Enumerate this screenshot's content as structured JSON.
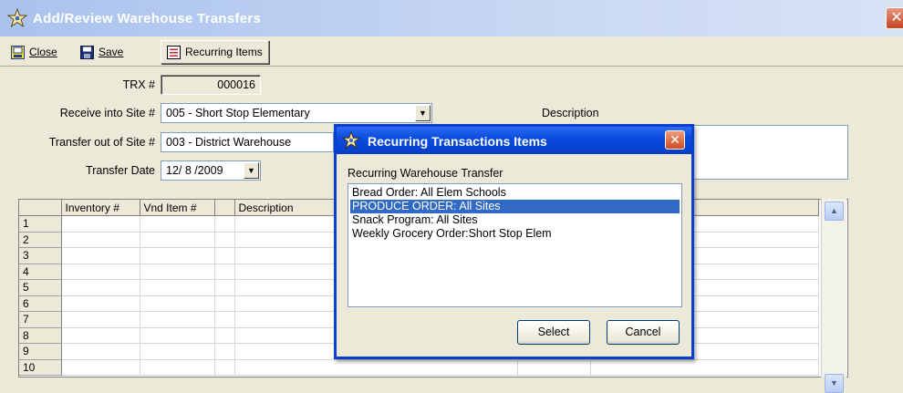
{
  "window": {
    "title": "Add/Review Warehouse Transfers",
    "close_glyph": "✕"
  },
  "toolbar": {
    "close_label": "Close",
    "save_label": "Save",
    "recurring_label": "Recurring Items"
  },
  "form": {
    "trx_label": "TRX #",
    "trx_value": "000016",
    "receive_label": "Receive into Site #",
    "receive_value": "005 - Short Stop Elementary",
    "transfer_out_label": "Transfer out of Site #",
    "transfer_out_value": "003 - District Warehouse",
    "transfer_date_label": "Transfer Date",
    "transfer_date_value": "12/ 8 /2009",
    "description_label": "Description"
  },
  "grid": {
    "columns": [
      "Inventory #",
      "Vnd Item #",
      "",
      "Description"
    ],
    "rows": [
      "1",
      "2",
      "3",
      "4",
      "5",
      "6",
      "7",
      "8",
      "9",
      "10"
    ]
  },
  "dialog": {
    "title": "Recurring Transactions Items",
    "close_glyph": "✕",
    "list_label": "Recurring Warehouse Transfer",
    "items": [
      "Bread Order: All Elem Schools",
      "PRODUCE ORDER: All Sites",
      "Snack Program: All Sites",
      "Weekly Grocery Order:Short Stop Elem"
    ],
    "selected_index": 1,
    "select_label": "Select",
    "cancel_label": "Cancel"
  },
  "colors": {
    "dialog_title": "#0a4cdf",
    "selection": "#316ac5",
    "window_bg": "#ece9d8"
  },
  "icons": [
    "app-star-icon",
    "close-icon",
    "save-icon",
    "recurring-items-icon",
    "dropdown-arrow-icon",
    "scroll-up-icon",
    "scroll-down-icon"
  ]
}
